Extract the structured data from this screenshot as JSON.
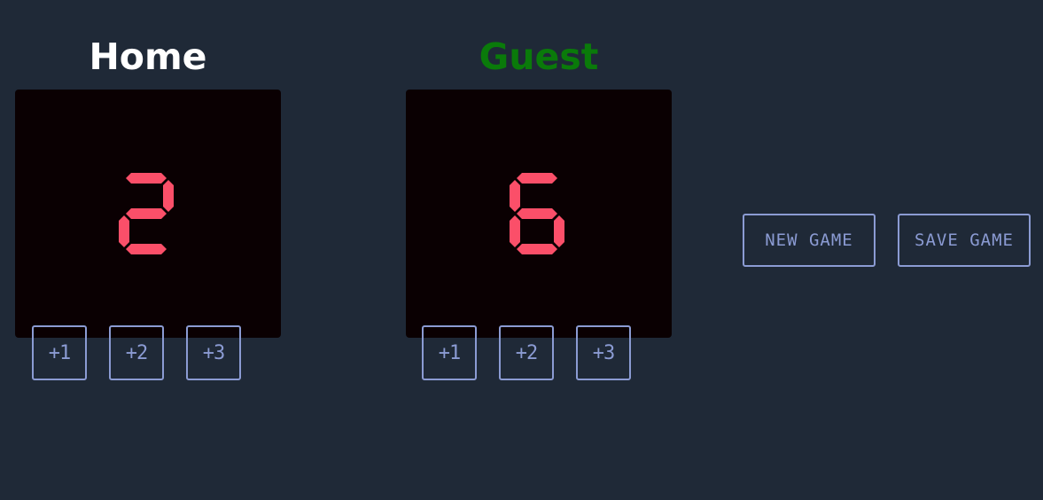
{
  "colors": {
    "background": "#1f2937",
    "home_title": "#ffffff",
    "guest_title": "#0a7a0a",
    "display_bg": "#0a0002",
    "digit_on": "#fb4f69",
    "button": "#8b9bd3"
  },
  "home": {
    "title": "Home",
    "score": "2",
    "buttons": [
      "+1",
      "+2",
      "+3"
    ]
  },
  "guest": {
    "title": "Guest",
    "score": "6",
    "buttons": [
      "+1",
      "+2",
      "+3"
    ]
  },
  "actions": {
    "new_game": "NEW GAME",
    "save_game": "SAVE GAME"
  }
}
